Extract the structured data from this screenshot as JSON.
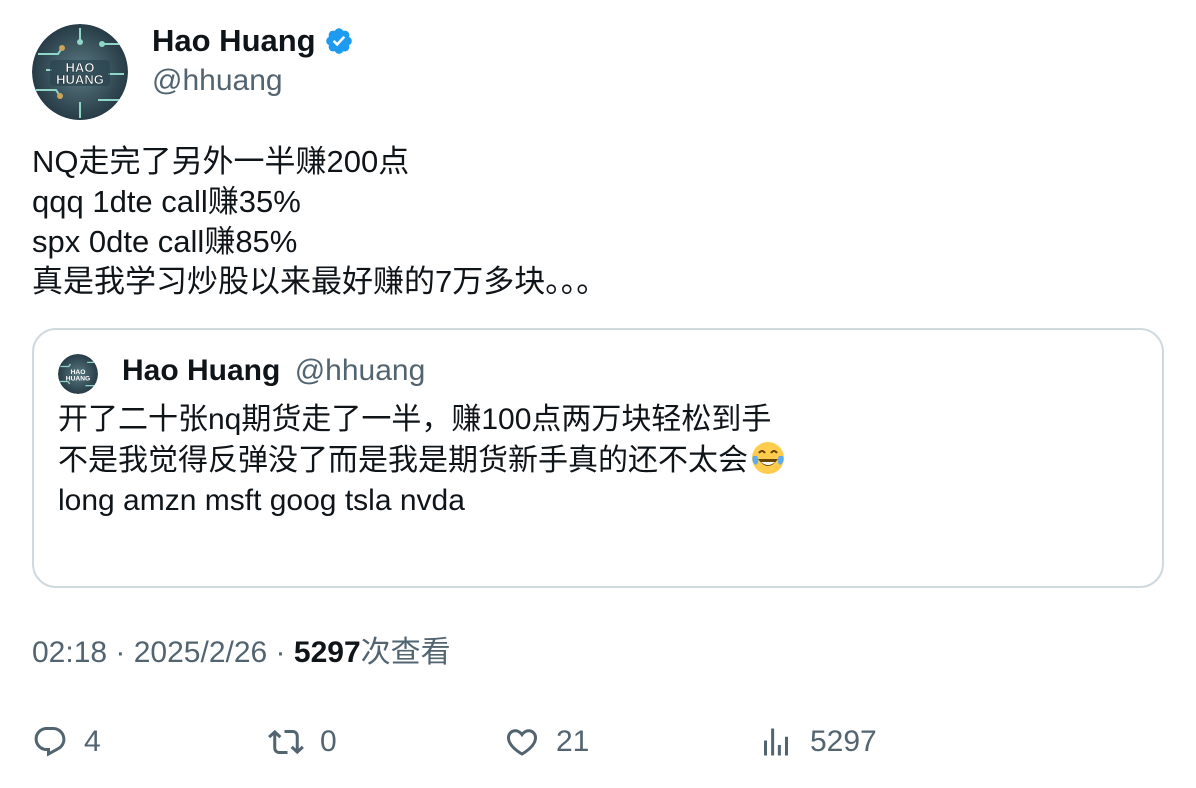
{
  "author": {
    "name": "Hao Huang",
    "handle": "@hhuang",
    "avatar_text": "HAO HUANG",
    "verified": true,
    "verified_color": "#1d9bf0"
  },
  "tweet": {
    "lines": [
      "NQ走完了另外一半赚200点",
      "qqq 1dte call赚35%",
      "spx 0dte call赚85%",
      "真是我学习炒股以来最好赚的7万多块。。。"
    ]
  },
  "quote": {
    "name": "Hao Huang",
    "handle": "@hhuang",
    "avatar_text": "HAO HUANG",
    "lines": [
      "开了二十张nq期货走了一半，赚100点两万块轻松到手",
      "不是我觉得反弹没了而是我是期货新手真的还不太会",
      "long amzn msft goog tsla nvda"
    ],
    "emoji": "face-with-tears-of-joy"
  },
  "meta": {
    "time": "02:18",
    "separator": " · ",
    "date": "2025/2/26",
    "views": "5297",
    "views_suffix": "次查看"
  },
  "actions": {
    "replies": "4",
    "retweets": "0",
    "likes": "21",
    "views": "5297"
  },
  "colors": {
    "text_primary": "#0f1419",
    "text_secondary": "#536471",
    "border": "#cfd9de"
  }
}
